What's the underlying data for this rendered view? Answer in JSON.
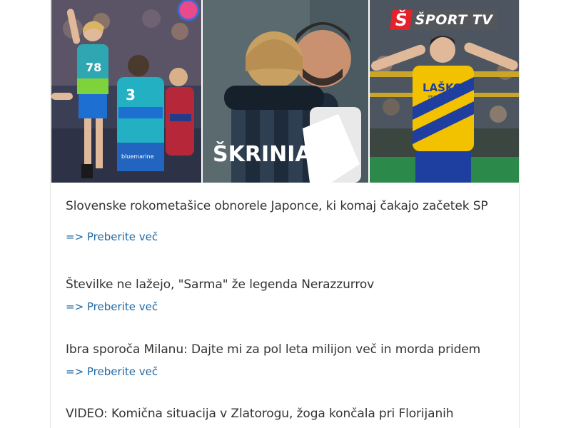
{
  "images": [
    {
      "icon": "handball-players-photo"
    },
    {
      "icon": "football-players-hug-photo",
      "jersey_text": "ŠKRINIAR"
    },
    {
      "icon": "handball-player-celebration-photo",
      "jersey_text": "LAŠKO",
      "jersey_subtext": "PIVOVARNA"
    }
  ],
  "logo": {
    "mark": "Š",
    "text": "ŠPORT TV",
    "color": "#e3222b"
  },
  "articles": [
    {
      "title": "Slovenske rokometašice obnorele Japonce, ki komaj čakajo začetek SP",
      "link": "=> Preberite več"
    },
    {
      "title": "Številke ne lažejo, \"Sarma\" že legenda Nerazzurrov",
      "link": "=> Preberite več"
    },
    {
      "title": "Ibra sporoča Milanu: Dajte mi za pol leta milijon več in morda pridem",
      "link": "=> Preberite več"
    },
    {
      "title": "VIDEO: Komična situacija v Zlatorogu, žoga končala pri Florijanih"
    }
  ],
  "colors": {
    "link": "#1f68a3",
    "title": "#333333"
  }
}
